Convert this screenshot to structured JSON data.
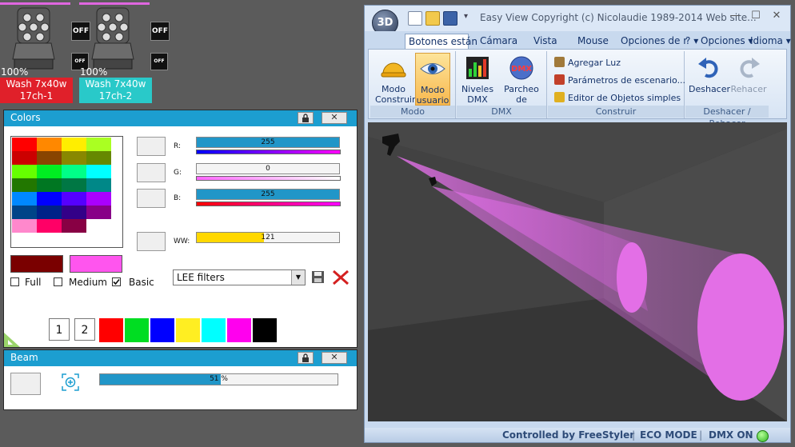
{
  "fixtures": [
    {
      "name": "Wash 7x40w",
      "channel": "17ch-1",
      "dimmer": "100%",
      "off1": "OFF",
      "off2": "OFF",
      "label_color": "#e0202a"
    },
    {
      "name": "Wash 7x40w",
      "channel": "17ch-2",
      "dimmer": "100%",
      "off1": "OFF",
      "off2": "OFF",
      "label_color": "#29c9c9"
    }
  ],
  "colors_panel": {
    "title": "Colors",
    "swatches": [
      "#ff0000",
      "#ff8800",
      "#ffee00",
      "#aaff22",
      "#cc0000",
      "#884400",
      "#888800",
      "#668800",
      "#66ff00",
      "#00ee22",
      "#00ff88",
      "#00ffff",
      "#227700",
      "#007722",
      "#007744",
      "#008888",
      "#0088ff",
      "#0000ff",
      "#5500ff",
      "#aa00ff",
      "#004488",
      "#002288",
      "#330088",
      "#880088",
      "#ff88cc",
      "#ff0066",
      "#880044",
      "#ffffff"
    ],
    "sliders": [
      {
        "label": "R:",
        "value": "255",
        "level": 1.0,
        "fill": "#2196c8",
        "gradient": [
          "#0000ff",
          "#ff00ff"
        ]
      },
      {
        "label": "G:",
        "value": "0",
        "level": 0.0,
        "fill": "#2196c8",
        "gradient": [
          "#ff66ff",
          "#ffffff"
        ]
      },
      {
        "label": "B:",
        "value": "255",
        "level": 1.0,
        "fill": "#2196c8",
        "gradient": [
          "#ff0000",
          "#ff00ff"
        ]
      },
      {
        "label": "WW:",
        "value": "121",
        "level": 0.47,
        "fill": "#ffd800",
        "gradient": null
      }
    ],
    "preview_old": "#7a0000",
    "preview_new": "#ff55ee",
    "filter_select": "LEE filters",
    "checkboxes": [
      {
        "label": "Full",
        "checked": false
      },
      {
        "label": "Medium",
        "checked": false
      },
      {
        "label": "Basic",
        "checked": true
      }
    ],
    "pages": [
      "1",
      "2"
    ],
    "quick_colors": [
      "#ff0000",
      "#00dd22",
      "#0000ff",
      "#ffee22",
      "#00ffff",
      "#ff00ee",
      "#000000"
    ]
  },
  "beam_panel": {
    "title": "Beam",
    "value": "51 %",
    "level": 0.51
  },
  "window": {
    "title": "Easy View  Copyright (c) Nicolaudie 1989-2014  Web site...",
    "app_badge": "3D",
    "tabs": [
      "Botones están",
      "Cámara",
      "Vista",
      "Mouse",
      "Opciones de r"
    ],
    "right_tabs": [
      "?",
      "Opciones",
      "Idioma"
    ],
    "ribbon": {
      "modo": {
        "label": "Modo",
        "buttons": [
          "Modo Construir",
          "Modo usuario"
        ]
      },
      "dmx": {
        "label": "DMX",
        "buttons": [
          "Niveles DMX",
          "Parcheo de Universos"
        ]
      },
      "construir": {
        "label": "Construir",
        "items": [
          "Agregar Luz",
          "Parámetros de escenario...",
          "Editor de Objetos simples"
        ]
      },
      "deshacer": {
        "label": "Deshacer / Rehacer",
        "buttons": [
          "Deshacer",
          "Rehacer"
        ]
      }
    },
    "status": {
      "controlled": "Controlled by FreeStyler",
      "eco": "ECO MODE",
      "dmx": "DMX ON"
    }
  }
}
